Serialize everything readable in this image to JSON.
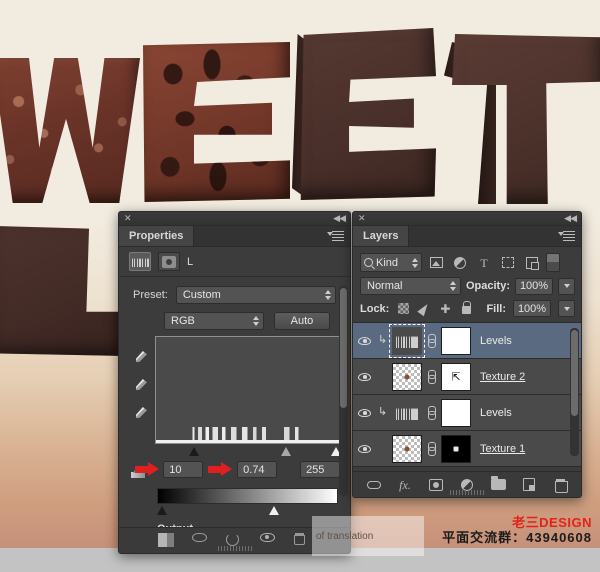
{
  "artwork": {
    "letters": [
      {
        "char": "W",
        "style": "chocolate-texture"
      },
      {
        "char": "E",
        "style": "chocolate-chunks"
      },
      {
        "char": "E",
        "style": "dark-3d"
      },
      {
        "char": "T",
        "style": "dark-3d"
      },
      {
        "char": "L",
        "style": "dark-3d"
      }
    ]
  },
  "properties_panel": {
    "tab_label": "Properties",
    "close_icon": "close-icon",
    "collapse_icon": "double-chevron-left-icon",
    "menu_icon": "panel-menu-icon",
    "adjustment_icon": "levels-histogram-icon",
    "mask_icon": "layer-mask-icon",
    "layer_label": "L",
    "preset_label": "Preset:",
    "preset_value": "Custom",
    "channel_value": "RGB",
    "auto_button": "Auto",
    "eyedroppers": [
      "black-point-eyedropper",
      "gray-point-eyedropper",
      "white-point-eyedropper"
    ],
    "input_levels": {
      "shadow": "10",
      "midtone": "0.74",
      "highlight": "255"
    },
    "output_levels": {
      "label": "Output Levels:",
      "black": "0",
      "white": "192"
    },
    "footer_icons": [
      "clip-to-layer-icon",
      "view-previous-state-icon",
      "reset-icon",
      "toggle-visibility-icon",
      "delete-adjustment-icon"
    ]
  },
  "layers_panel": {
    "tab_label": "Layers",
    "close_icon": "close-icon",
    "collapse_icon": "double-chevron-left-icon",
    "menu_icon": "panel-menu-icon",
    "filter_kind": "Kind",
    "filter_type_icons": [
      "filter-pixel-icon",
      "filter-adjustment-icon",
      "filter-type-icon",
      "filter-shape-icon",
      "filter-smart-object-icon"
    ],
    "filter_toggle": "filter-enable-toggle",
    "blend_mode": "Normal",
    "opacity_label": "Opacity:",
    "opacity_value": "100%",
    "lock_label": "Lock:",
    "lock_icons": [
      "lock-transparent-pixels-icon",
      "lock-image-pixels-icon",
      "lock-position-icon",
      "lock-all-icon"
    ],
    "fill_label": "Fill:",
    "fill_value": "100%",
    "layers": [
      {
        "name": "Levels",
        "type": "adjustment",
        "selected": true,
        "underline": false,
        "mask": "white",
        "clipped": true
      },
      {
        "name": "Texture 2",
        "type": "pixel",
        "selected": false,
        "underline": true,
        "mask": "white",
        "clipped": false
      },
      {
        "name": "Levels",
        "type": "adjustment",
        "selected": false,
        "underline": false,
        "mask": "white",
        "clipped": true
      },
      {
        "name": "Texture 1",
        "type": "pixel",
        "selected": false,
        "underline": true,
        "mask": "black",
        "clipped": false
      }
    ],
    "footer_icons": [
      "link-layers-icon",
      "layer-style-fx-icon",
      "add-layer-mask-icon",
      "new-adjustment-layer-icon",
      "new-group-icon",
      "new-layer-icon",
      "delete-layer-icon"
    ]
  },
  "overlay": {
    "translation_note": "of translation"
  },
  "watermark": {
    "brand": "老三DESIGN",
    "qq_group": "平面交流群：43940608",
    "brand_color": "#e2231a"
  }
}
